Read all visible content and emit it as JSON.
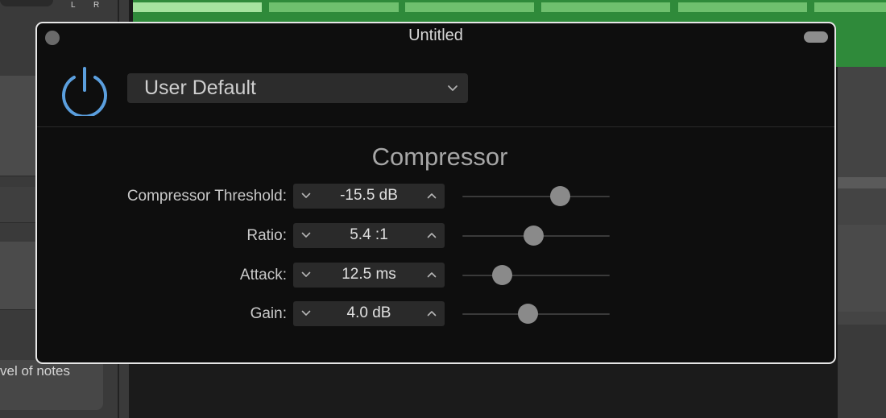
{
  "background": {
    "pan_left": "L",
    "pan_right": "R",
    "notes_text": "vel of notes"
  },
  "window": {
    "title": "Untitled",
    "preset": {
      "selected": "User Default"
    },
    "power_on": true,
    "section_title": "Compressor"
  },
  "parameters": [
    {
      "label": "Compressor Threshold:",
      "value": "-15.5 dB",
      "slider_fraction": 0.66
    },
    {
      "label": "Ratio:",
      "value": "5.4 :1",
      "slider_fraction": 0.48
    },
    {
      "label": "Attack:",
      "value": "12.5 ms",
      "slider_fraction": 0.27
    },
    {
      "label": "Gain:",
      "value": "4.0 dB",
      "slider_fraction": 0.44
    }
  ],
  "colors": {
    "power_icon": "#5b9fde",
    "window_bg": "#0e0e0e",
    "track_green": "#2f8a3a"
  }
}
